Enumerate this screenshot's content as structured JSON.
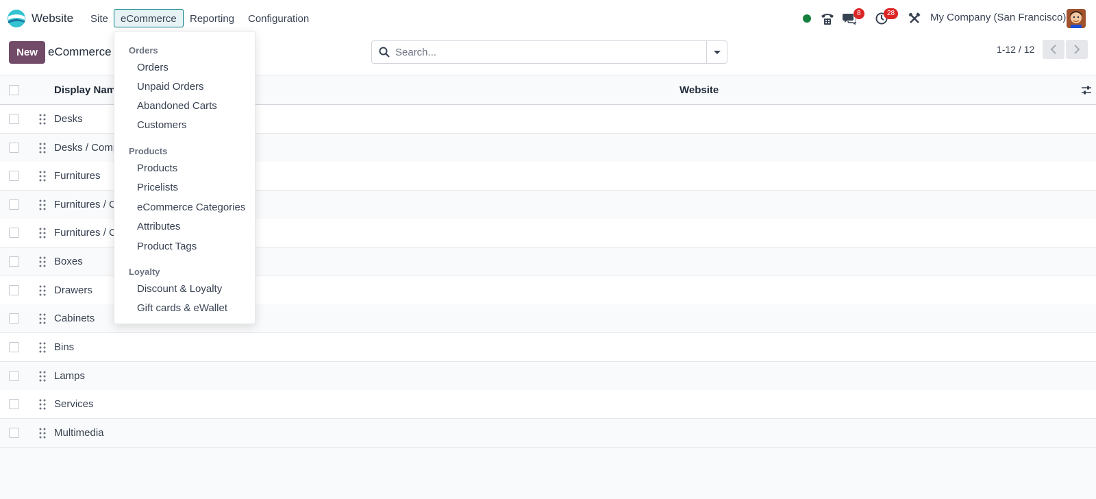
{
  "navbar": {
    "app_name": "Website",
    "menu": [
      "Site",
      "eCommerce",
      "Reporting",
      "Configuration"
    ],
    "active_menu": "eCommerce",
    "messages_badge": "8",
    "activities_badge": "28",
    "company": "My Company (San Francisco)",
    "colors": {
      "accent": "#714b67",
      "active_border": "#017e84",
      "badge": "#dc2626",
      "presence": "#15803d"
    }
  },
  "control_panel": {
    "new_label": "New",
    "breadcrumb": "eCommerce",
    "search_placeholder": "Search...",
    "pager": "1-12 / 12"
  },
  "list": {
    "columns": [
      "Display Name",
      "Website"
    ],
    "rows": [
      {
        "name": "Desks"
      },
      {
        "name": "Desks / Comp"
      },
      {
        "name": "Furnitures"
      },
      {
        "name": "Furnitures / C"
      },
      {
        "name": "Furnitures / C"
      },
      {
        "name": "Boxes"
      },
      {
        "name": "Drawers"
      },
      {
        "name": "Cabinets"
      },
      {
        "name": "Bins"
      },
      {
        "name": "Lamps"
      },
      {
        "name": "Services"
      },
      {
        "name": "Multimedia"
      }
    ]
  },
  "dropdown": {
    "sections": [
      {
        "header": "Orders",
        "items": [
          "Orders",
          "Unpaid Orders",
          "Abandoned Carts",
          "Customers"
        ]
      },
      {
        "header": "Products",
        "items": [
          "Products",
          "Pricelists",
          "eCommerce Categories",
          "Attributes",
          "Product Tags"
        ]
      },
      {
        "header": "Loyalty",
        "items": [
          "Discount & Loyalty",
          "Gift cards & eWallet"
        ]
      }
    ]
  }
}
